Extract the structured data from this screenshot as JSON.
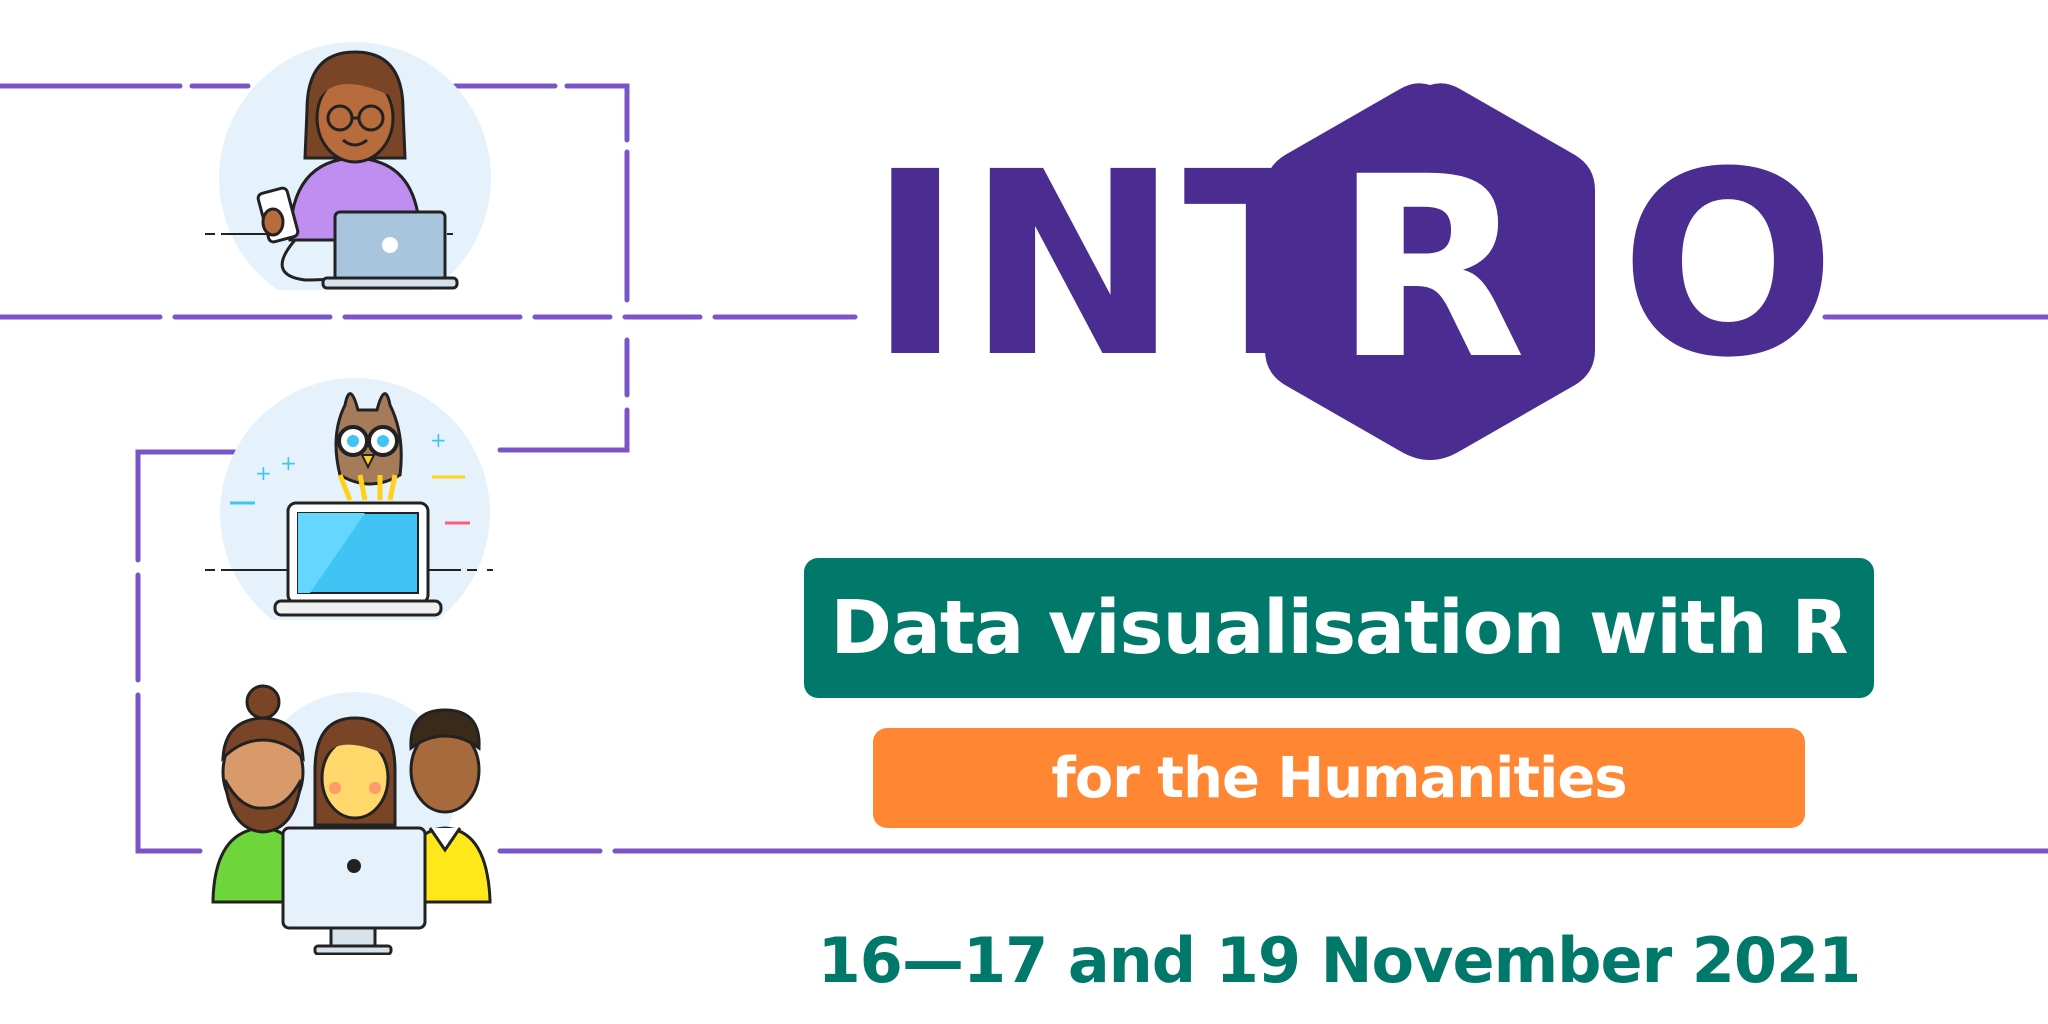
{
  "logo": {
    "prefix": "INT",
    "hex_letter": "R",
    "suffix": "O",
    "color": "#4b2d91"
  },
  "title_banner": {
    "text": "Data visualisation with R",
    "color": "#00786a"
  },
  "subtitle_banner": {
    "text": "for the Humanities",
    "color": "#ff8632"
  },
  "date": {
    "text": "16—17 and 19 November 2021",
    "color": "#00786a"
  },
  "line_color": "#7b55c7",
  "illustrations": [
    {
      "name": "woman-with-phone-and-laptop-illustration"
    },
    {
      "name": "owl-on-laptop-illustration"
    },
    {
      "name": "group-at-computer-illustration"
    }
  ]
}
